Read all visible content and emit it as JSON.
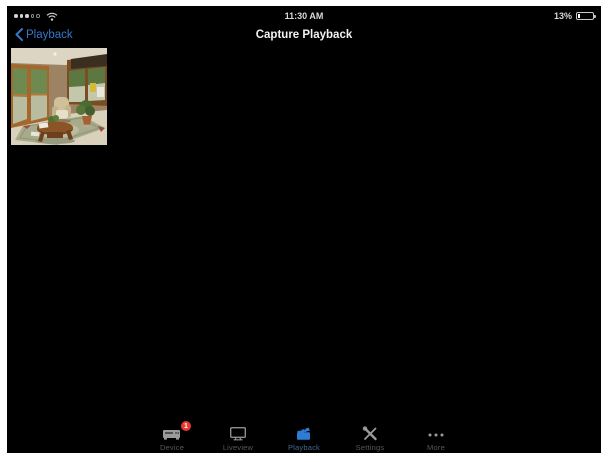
{
  "status_bar": {
    "time": "11:30 AM",
    "battery_percent": "13%",
    "signal_icon": "signal-dots-3-of-5",
    "wifi_icon": "wifi-icon"
  },
  "nav_bar": {
    "back_label": "Playback",
    "title": "Capture Playback"
  },
  "content": {
    "thumbnail_icon": "living-room-capture-thumbnail"
  },
  "tab_bar": {
    "items": [
      {
        "label": "Device",
        "icon": "dvr-device-icon",
        "badge": "1"
      },
      {
        "label": "Liveview",
        "icon": "monitor-icon"
      },
      {
        "label": "Playback",
        "icon": "clapperboard-icon",
        "active": true
      },
      {
        "label": "Settings",
        "icon": "tools-icon"
      },
      {
        "label": "More",
        "icon": "ellipsis-icon"
      }
    ]
  },
  "colors": {
    "accent_blue": "#3578c8",
    "active_tab_blue": "#2d7cd6",
    "badge_red": "#e6392f",
    "screen_background": "#000000"
  }
}
